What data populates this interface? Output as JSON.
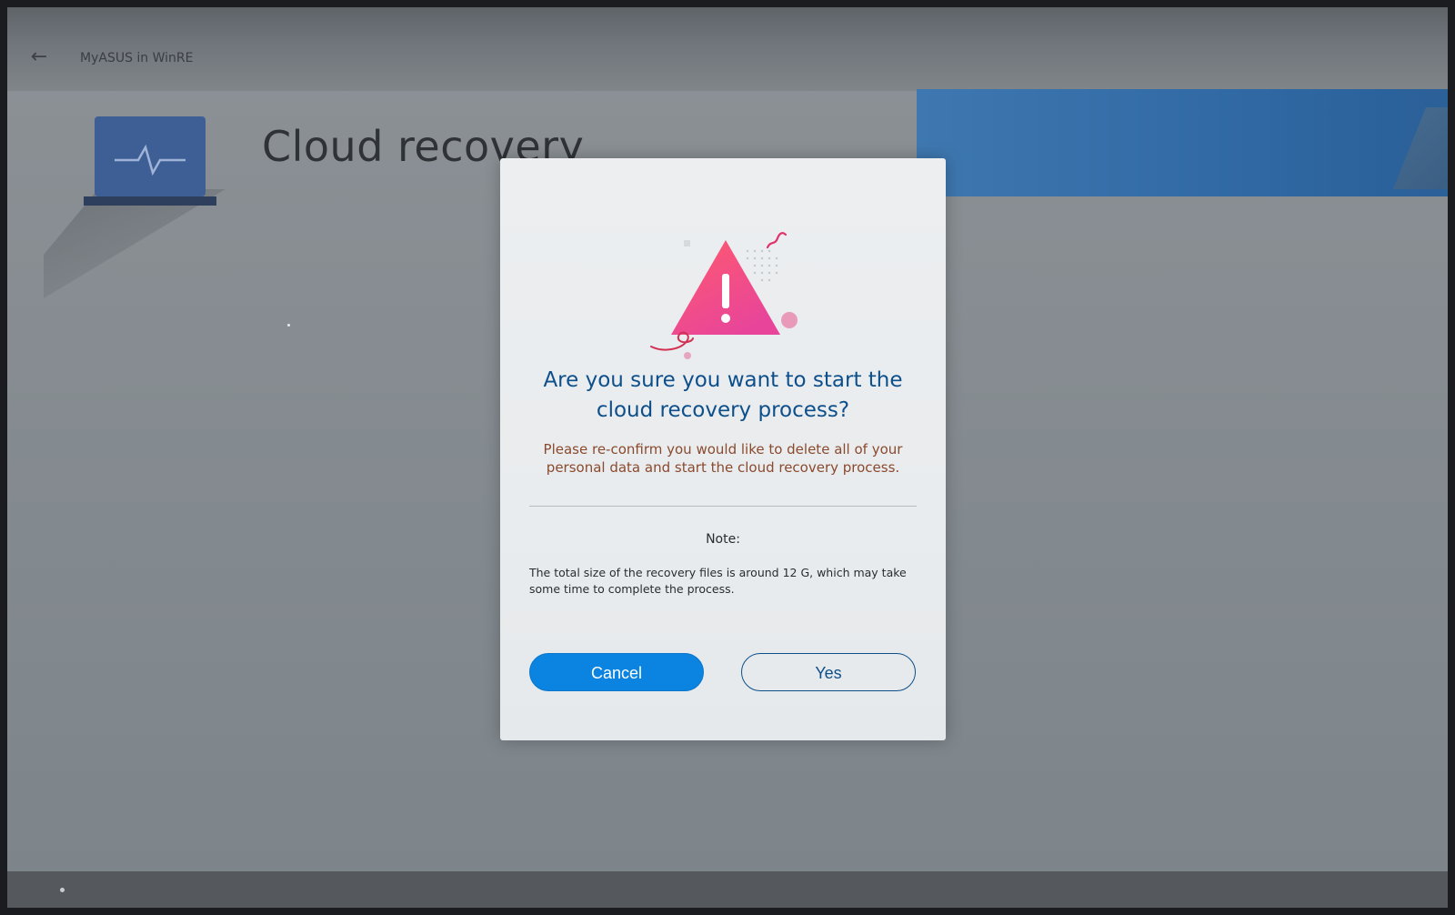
{
  "window": {
    "back_icon": "back-arrow-icon",
    "app_title": "MyASUS in WinRE"
  },
  "page": {
    "title": "Cloud recovery",
    "hero_icon": "laptop-heartbeat-icon"
  },
  "dialog": {
    "icon": "warning-triangle-icon",
    "heading_line1": "Are you sure you want to start the",
    "heading_line2": "cloud recovery process?",
    "message_line1": "Please re-confirm you would like to delete all of your",
    "message_line2": "personal data and start the cloud recovery process.",
    "note_label": "Note:",
    "note_text": "The total size of the recovery files is around 12 G, which may take some time to complete the process.",
    "cancel_label": "Cancel",
    "yes_label": "Yes"
  },
  "colors": {
    "heading": "#0d4f8b",
    "message": "#8a4a2e",
    "cancel_button": "#0a84e0",
    "banner": "#2f68a3",
    "warning": "#ee4b7c"
  }
}
